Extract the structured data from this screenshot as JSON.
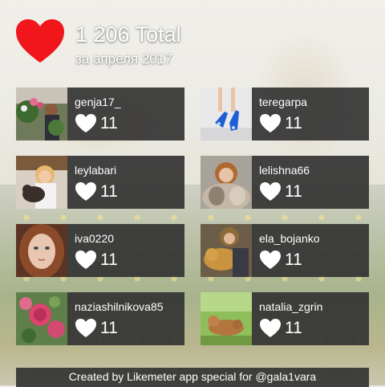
{
  "header": {
    "total": "1 206 Total",
    "period": "за апреля 2017"
  },
  "colors": {
    "accent": "#f0161b",
    "card_background": "#333333",
    "text": "#ffffff"
  },
  "icons": {
    "header": "heart-icon",
    "likes": "heart-outline-icon"
  },
  "users": [
    {
      "username": "genja17_",
      "likes": "11",
      "photo": "woman-with-flowers"
    },
    {
      "username": "teregarpa",
      "likes": "11",
      "photo": "blue-high-heels"
    },
    {
      "username": "leylabari",
      "likes": "11",
      "photo": "woman-with-cat"
    },
    {
      "username": "lelishna66",
      "likes": "11",
      "photo": "woman-in-fur"
    },
    {
      "username": "iva0220",
      "likes": "11",
      "photo": "woman-portrait"
    },
    {
      "username": "ela_bojanko",
      "likes": "11",
      "photo": "woman-with-dog"
    },
    {
      "username": "naziashilnikova85",
      "likes": "11",
      "photo": "pink-flowers"
    },
    {
      "username": "natalia_zgrin",
      "likes": "11",
      "photo": "dog-in-grass"
    }
  ],
  "footer": {
    "text": "Created by Likemeter app special for @gala1vara"
  }
}
